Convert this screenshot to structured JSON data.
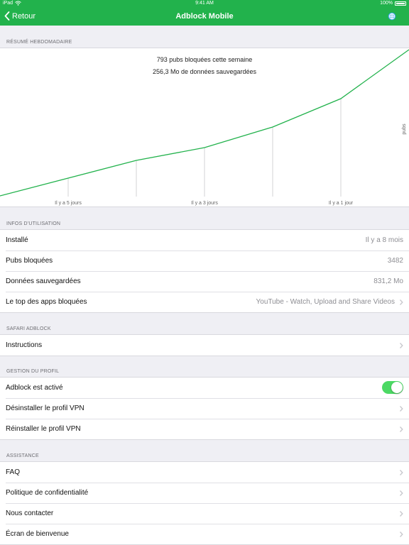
{
  "status_bar": {
    "device": "iPad",
    "time": "9:41 AM",
    "battery": "100%"
  },
  "nav": {
    "back_label": "Retour",
    "title": "Adblock Mobile"
  },
  "colors": {
    "accent": "#22b24c",
    "toggle_on": "#4cd964",
    "chart_line": "#22b24c"
  },
  "summary": {
    "header": "RÉSUMÉ HEBDOMADAIRE",
    "line1": "793 pubs bloquées cette semaine",
    "line2": "256,3 Mo de données sauvegardées"
  },
  "chart_data": {
    "type": "line",
    "title": "",
    "ylabel": "pubs",
    "x_tick_labels": [
      "Il y a 5 jours",
      "Il y a 3 jours",
      "Il y a 1 jour"
    ],
    "series": [
      {
        "values": [
          0,
          25,
          50,
          68,
          97,
          137,
          206
        ]
      }
    ],
    "grid": "vertical"
  },
  "usage": {
    "header": "INFOS D'UTILISATION",
    "rows": [
      {
        "label": "Installé",
        "value": "Il y a 8 mois"
      },
      {
        "label": "Pubs bloquées",
        "value": "3482"
      },
      {
        "label": "Données sauvegardées",
        "value": "831,2 Mo"
      },
      {
        "label": "Le top des apps bloquées",
        "value": "YouTube - Watch, Upload and Share Videos"
      }
    ]
  },
  "safari": {
    "header": "SAFARI ADBLOCK",
    "rows": [
      {
        "label": "Instructions"
      }
    ]
  },
  "profile": {
    "header": "GESTION DU PROFIL",
    "rows": [
      {
        "label": "Adblock est activé",
        "toggle_on": true
      },
      {
        "label": "Désinstaller le profil VPN"
      },
      {
        "label": "Réinstaller le profil VPN"
      }
    ]
  },
  "support": {
    "header": "ASSISTANCE",
    "rows": [
      {
        "label": "FAQ"
      },
      {
        "label": "Politique de confidentialité"
      },
      {
        "label": "Nous contacter"
      },
      {
        "label": "Écran de bienvenue"
      }
    ]
  }
}
